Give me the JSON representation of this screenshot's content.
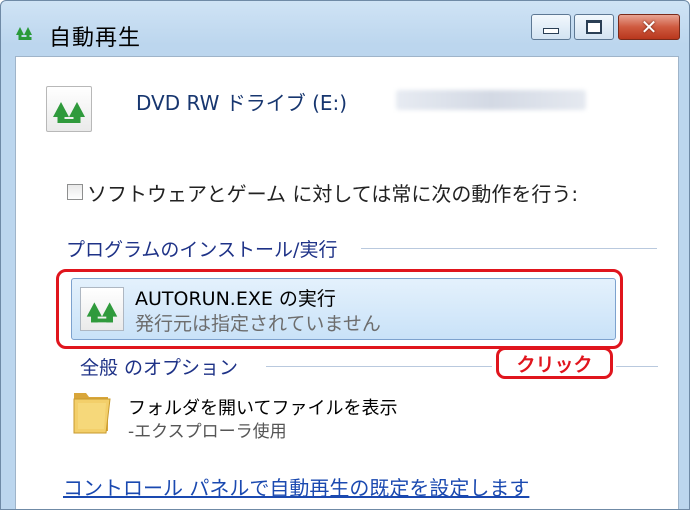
{
  "window": {
    "title": "自動再生",
    "controls": {
      "minimize_icon": "minimize-icon",
      "maximize_icon": "maximize-icon",
      "close_glyph": "✕"
    }
  },
  "drive": {
    "icon": "autoplay-drive-icon",
    "label": "DVD RW ドライブ (E:)"
  },
  "always_do": {
    "checked": false,
    "label": "ソフトウェアとゲーム に対しては常に次の動作を行う:"
  },
  "sections": {
    "install": "プログラムのインストール/実行",
    "general": "全般 のオプション"
  },
  "run_option": {
    "title": "AUTORUN.EXE の実行",
    "subtitle": "発行元は指定されていません",
    "icon": "autorun-icon"
  },
  "annotation": {
    "click_label": "クリック",
    "color": "#e0151d"
  },
  "folder_option": {
    "title": "フォルダを開いてファイルを表示",
    "subtitle": "-エクスプローラ使用",
    "icon": "folder-icon"
  },
  "footer": {
    "link": "コントロール パネルで自動再生の既定を設定します"
  },
  "colors": {
    "section_text": "#1e3287",
    "link": "#1a49b0",
    "highlight": "#c9e2f8",
    "titlebar": "#bcd6ee"
  }
}
